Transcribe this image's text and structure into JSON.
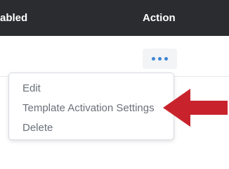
{
  "table": {
    "header": {
      "enabled_label": "abled",
      "action_label": "Action"
    }
  },
  "row": {
    "more_button_icon": "more-horizontal-icon"
  },
  "dropdown": {
    "items": [
      {
        "label": "Edit"
      },
      {
        "label": "Template Activation Settings"
      },
      {
        "label": "Delete"
      }
    ]
  },
  "annotation": {
    "arrow_icon": "arrow-left-icon",
    "arrow_color": "#c8232c"
  },
  "colors": {
    "header_bg": "#2b2c30",
    "header_text": "#ffffff",
    "accent_dots": "#3d86d6",
    "menu_text": "#6b7079"
  }
}
